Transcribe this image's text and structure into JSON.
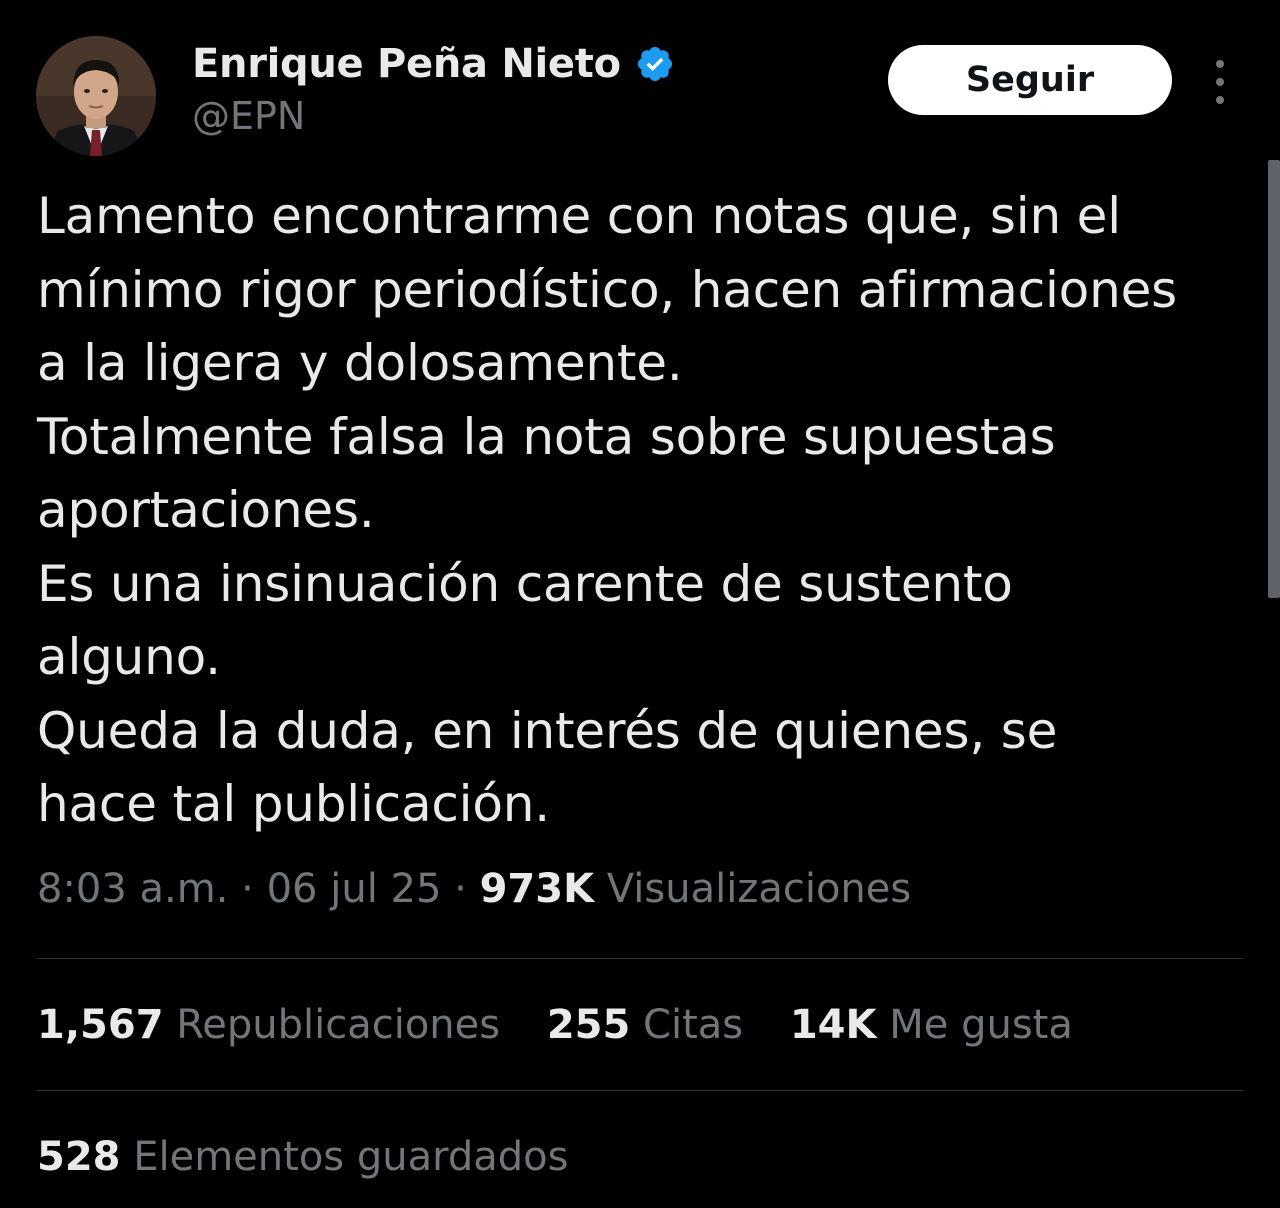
{
  "author": {
    "display_name": "Enrique Peña Nieto",
    "handle": "@EPN",
    "verified": true,
    "verified_color": "#1d9bf0"
  },
  "actions": {
    "follow_label": "Seguir",
    "more_icon": "more-vertical-icon"
  },
  "tweet": {
    "lines": [
      "Lamento encontrarme con notas que, sin el",
      "mínimo rigor periodístico, hacen afirmaciones",
      "a la ligera y dolosamente.",
      "Totalmente falsa la nota sobre supuestas",
      "aportaciones.",
      "Es una insinuación carente de sustento",
      "alguno.",
      "Queda la duda, en interés de quienes,  se",
      "hace tal publicación."
    ]
  },
  "meta": {
    "time": "8:03 a.m.",
    "separator": "·",
    "date": "06 jul 25",
    "views_count": "973K",
    "views_label": "Visualizaciones"
  },
  "stats": {
    "reposts_count": "1,567",
    "reposts_label": "Republicaciones",
    "quotes_count": "255",
    "quotes_label": "Citas",
    "likes_count": "14K",
    "likes_label": "Me gusta",
    "bookmarks_count": "528",
    "bookmarks_label": "Elementos guardados"
  },
  "colors": {
    "background": "#000000",
    "text_primary": "#e7e9ea",
    "text_secondary": "#71767b",
    "divider": "#2f3336",
    "button_bg": "#ffffff"
  }
}
